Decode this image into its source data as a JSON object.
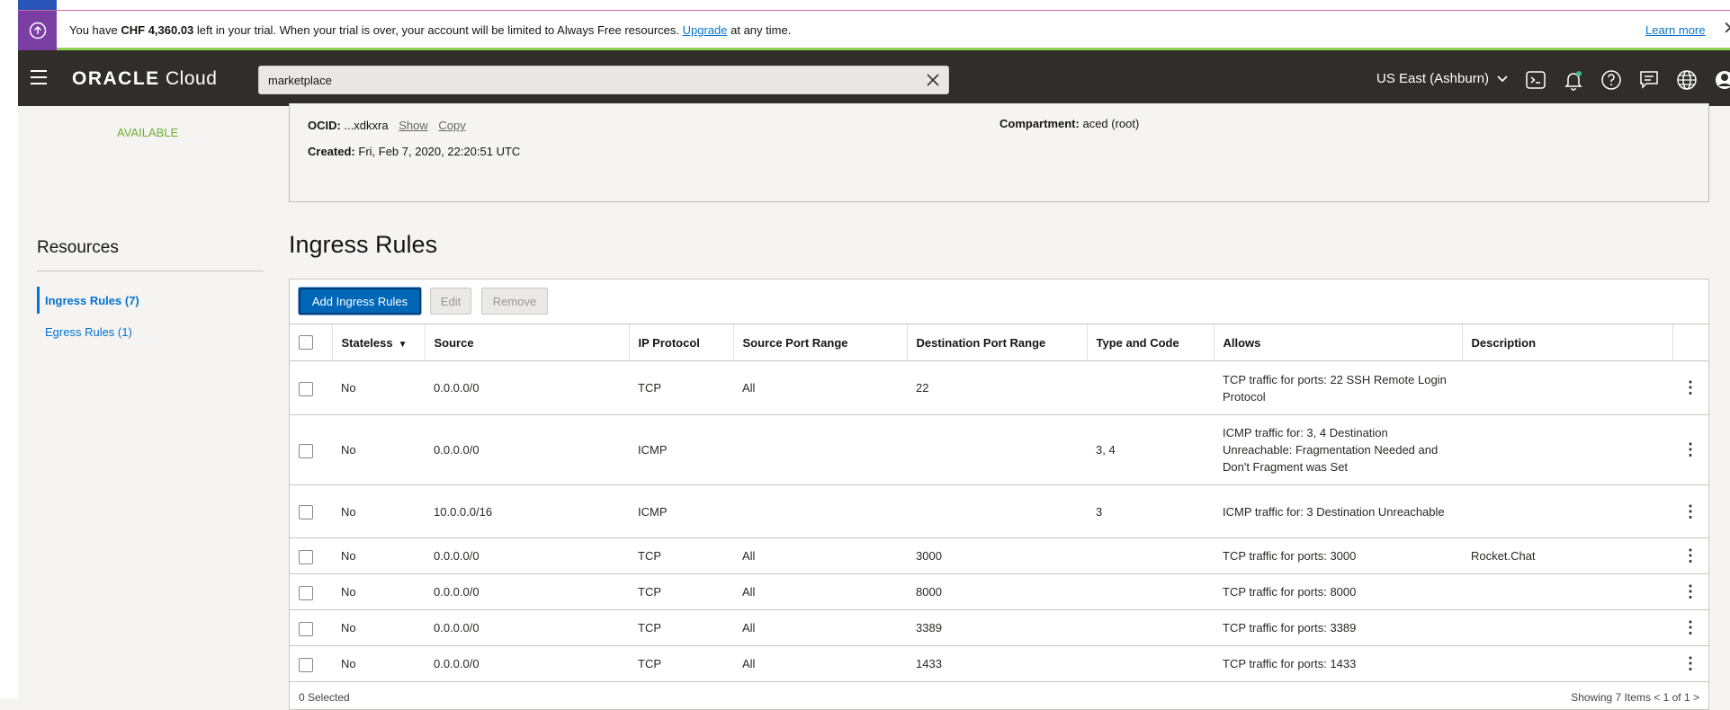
{
  "banner": {
    "text_before_amount": "You have ",
    "amount": "CHF 4,360.03",
    "text_after_amount": " left in your trial. When your trial is over, your account will be limited to Always Free resources. ",
    "upgrade_link": "Upgrade",
    "text_after_link": " at any time.",
    "learn_more": "Learn more",
    "close": "✕",
    "icon": "arrow-up-circle-icon",
    "accent_color": "#7b3ea3"
  },
  "header": {
    "logo_bold": "ORACLE",
    "logo_rest": " Cloud",
    "search_value": "marketplace",
    "region": "US East (Ashburn)",
    "icons": [
      "cloud-shell-icon",
      "bell-icon",
      "help-icon",
      "chat-icon",
      "globe-icon",
      "profile-icon"
    ]
  },
  "detail": {
    "status": "AVAILABLE",
    "ocid_label": "OCID:",
    "ocid_value": "...xdkxra",
    "show_link": "Show",
    "copy_link": "Copy",
    "created_label": "Created:",
    "created_value": "Fri, Feb 7, 2020, 22:20:51 UTC",
    "compartment_label": "Compartment:",
    "compartment_value": "aced (root)"
  },
  "resources": {
    "title": "Resources",
    "items": [
      {
        "label": "Ingress Rules (7)",
        "active": true
      },
      {
        "label": "Egress Rules (1)",
        "active": false
      }
    ]
  },
  "ingress": {
    "title": "Ingress Rules",
    "add_button": "Add Ingress Rules",
    "edit_button": "Edit",
    "remove_button": "Remove",
    "columns": [
      "Stateless",
      "Source",
      "IP Protocol",
      "Source Port Range",
      "Destination Port Range",
      "Type and Code",
      "Allows",
      "Description"
    ],
    "rows": [
      {
        "stateless": "No",
        "source": "0.0.0.0/0",
        "protocol": "TCP",
        "src_port": "All",
        "dst_port": "22",
        "type_code": "",
        "allows": "TCP traffic for ports: 22 SSH Remote Login Protocol",
        "description": ""
      },
      {
        "stateless": "No",
        "source": "0.0.0.0/0",
        "protocol": "ICMP",
        "src_port": "",
        "dst_port": "",
        "type_code": "3, 4",
        "allows": "ICMP traffic for: 3, 4 Destination Unreachable: Fragmentation Needed and Don't Fragment was Set",
        "description": ""
      },
      {
        "stateless": "No",
        "source": "10.0.0.0/16",
        "protocol": "ICMP",
        "src_port": "",
        "dst_port": "",
        "type_code": "3",
        "allows": "ICMP traffic for: 3 Destination Unreachable",
        "description": ""
      },
      {
        "stateless": "No",
        "source": "0.0.0.0/0",
        "protocol": "TCP",
        "src_port": "All",
        "dst_port": "3000",
        "type_code": "",
        "allows": "TCP traffic for ports: 3000",
        "description": "Rocket.Chat"
      },
      {
        "stateless": "No",
        "source": "0.0.0.0/0",
        "protocol": "TCP",
        "src_port": "All",
        "dst_port": "8000",
        "type_code": "",
        "allows": "TCP traffic for ports: 8000",
        "description": ""
      },
      {
        "stateless": "No",
        "source": "0.0.0.0/0",
        "protocol": "TCP",
        "src_port": "All",
        "dst_port": "3389",
        "type_code": "",
        "allows": "TCP traffic for ports: 3389",
        "description": ""
      },
      {
        "stateless": "No",
        "source": "0.0.0.0/0",
        "protocol": "TCP",
        "src_port": "All",
        "dst_port": "1433",
        "type_code": "",
        "allows": "TCP traffic for ports: 1433",
        "description": ""
      }
    ],
    "footer_selected": "0 Selected",
    "footer_showing": "Showing 7 Items",
    "footer_page": "1 of 1"
  }
}
